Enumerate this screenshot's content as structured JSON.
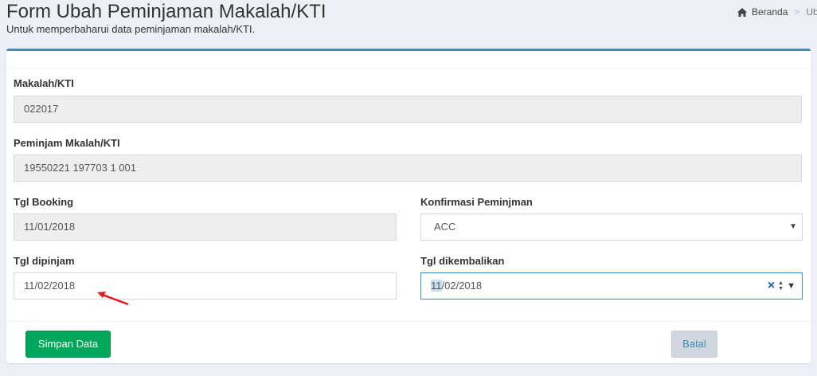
{
  "header": {
    "title": "Form Ubah Peminjaman Makalah/KTI",
    "subtitle": "Untuk memperbaharui data peminjaman makalah/KTI."
  },
  "breadcrumb": {
    "home_label": "Beranda",
    "separator": ">",
    "current": "Ub"
  },
  "form": {
    "makalah": {
      "label": "Makalah/KTI",
      "value": "022017"
    },
    "peminjam": {
      "label": "Peminjam Mkalah/KTI",
      "value": "19550221 197703 1 001"
    },
    "tgl_booking": {
      "label": "Tgl Booking",
      "value": "11/01/2018"
    },
    "konfirmasi": {
      "label": "Konfirmasi Peminjman",
      "value": "ACC",
      "options": [
        "ACC"
      ]
    },
    "tgl_dipinjam": {
      "label": "Tgl dipinjam",
      "value": "11/02/2018"
    },
    "tgl_dikembalikan": {
      "label": "Tgl dikembalikan",
      "value_highlight": "11",
      "value_rest": "/02/2018"
    }
  },
  "footer": {
    "save_label": "Simpan Data",
    "cancel_label": "Batal"
  },
  "colors": {
    "primary": "#3c8dbc",
    "success": "#00a65a",
    "annotation": "#e31b23"
  }
}
